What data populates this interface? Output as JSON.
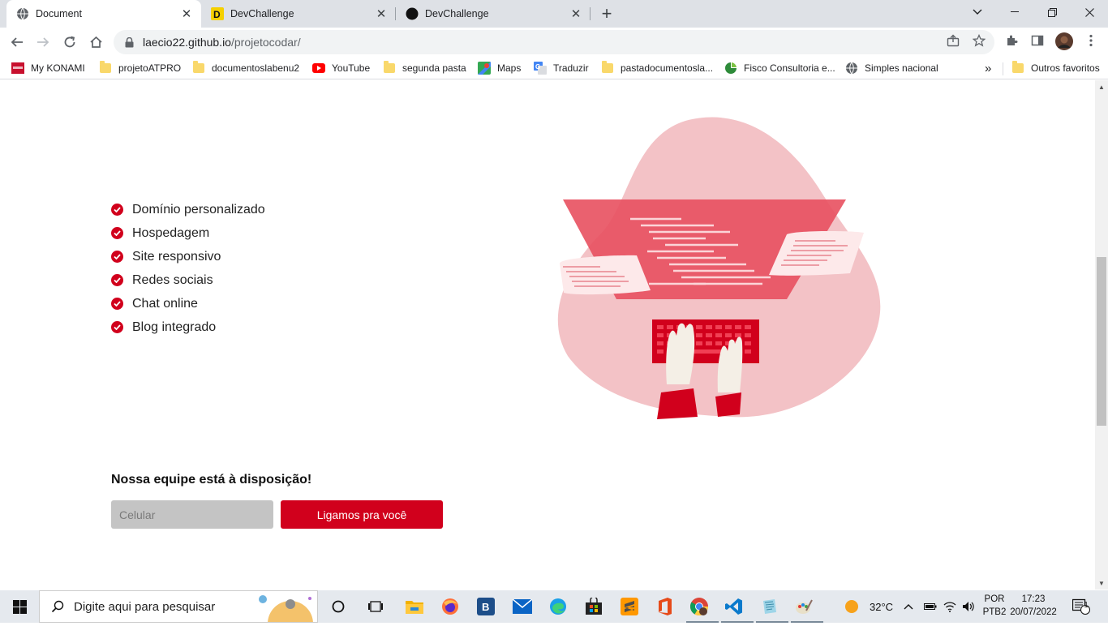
{
  "browser": {
    "tabs": [
      {
        "title": "Document",
        "active": true
      },
      {
        "title": "DevChallenge",
        "active": false
      },
      {
        "title": "DevChallenge",
        "active": false
      }
    ],
    "url_host": "laecio22.github.io",
    "url_path": "/projetocodar/",
    "bookmarks": [
      {
        "label": "My KONAMI",
        "icon": "konami-icon"
      },
      {
        "label": "projetoATPRO",
        "icon": "folder-icon"
      },
      {
        "label": "documentoslabenu2",
        "icon": "folder-icon"
      },
      {
        "label": "YouTube",
        "icon": "youtube-icon"
      },
      {
        "label": "segunda pasta",
        "icon": "folder-icon"
      },
      {
        "label": "Maps",
        "icon": "maps-icon"
      },
      {
        "label": "Traduzir",
        "icon": "translate-icon"
      },
      {
        "label": "pastadocumentosla...",
        "icon": "folder-icon"
      },
      {
        "label": "Fisco Consultoria e...",
        "icon": "fisco-icon"
      },
      {
        "label": "Simples nacional",
        "icon": "globe-icon"
      }
    ],
    "other_bookmarks": "Outros favoritos",
    "overflow": "»"
  },
  "page": {
    "features": [
      "Domínio personalizado",
      "Hospedagem",
      "Site responsivo",
      "Redes sociais",
      "Chat online",
      "Blog integrado"
    ],
    "cta_title": "Nossa equipe está à disposição!",
    "phone_placeholder": "Celular",
    "call_button": "Ligamos pra você",
    "accent_color": "#d1001c"
  },
  "taskbar": {
    "search_placeholder": "Digite aqui para pesquisar",
    "weather": "32°C",
    "lang_top": "POR",
    "lang_bottom": "PTB2",
    "time": "17:23",
    "date": "20/07/2022",
    "notifications": "1"
  }
}
